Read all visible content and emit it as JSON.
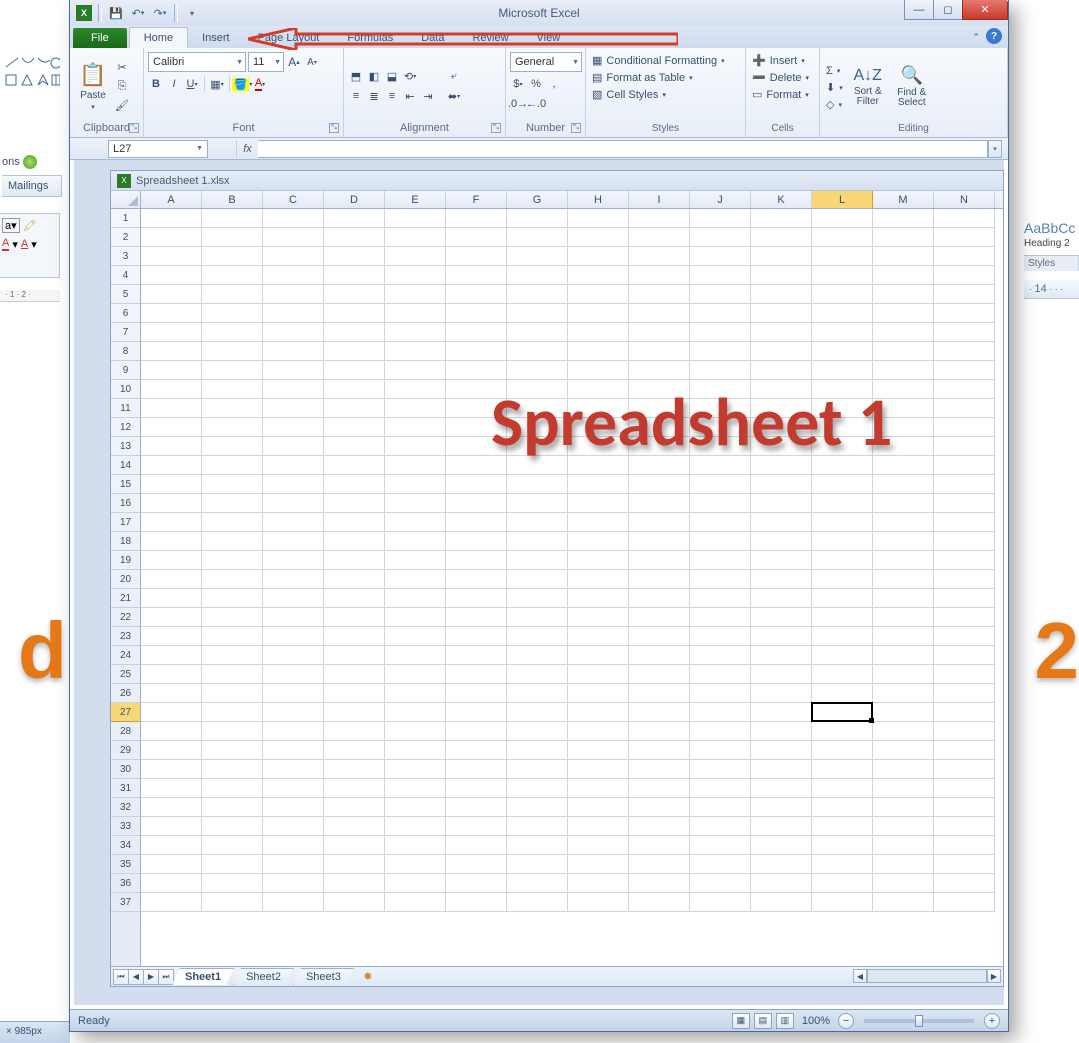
{
  "background_app": {
    "partial_tab": "Mailings",
    "partial_ons": "ons",
    "style_sample": "AaBbCc",
    "style_name": "Heading 2",
    "style_group": "Styles",
    "ruler_label": "14",
    "status_dims": "× 985px",
    "big_d": "d",
    "big_2": "2"
  },
  "excel": {
    "title": "Microsoft Excel",
    "qat_tooltip": {
      "save": "Save",
      "undo": "Undo",
      "redo": "Redo"
    },
    "tabs": [
      "File",
      "Home",
      "Insert",
      "Page Layout",
      "Formulas",
      "Data",
      "Review",
      "View"
    ],
    "active_tab": "Home",
    "ribbon": {
      "clipboard": {
        "label": "Clipboard",
        "paste": "Paste"
      },
      "font": {
        "label": "Font",
        "name": "Calibri",
        "size": "11"
      },
      "alignment": {
        "label": "Alignment"
      },
      "number": {
        "label": "Number",
        "format": "General"
      },
      "styles": {
        "label": "Styles",
        "cond": "Conditional Formatting",
        "table": "Format as Table",
        "cell": "Cell Styles"
      },
      "cells": {
        "label": "Cells",
        "insert": "Insert",
        "delete": "Delete",
        "format": "Format"
      },
      "editing": {
        "label": "Editing",
        "sort": "Sort & Filter",
        "find": "Find & Select"
      }
    },
    "namebox": "L27",
    "document_title": "Spreadsheet 1.xlsx",
    "columns": [
      "A",
      "B",
      "C",
      "D",
      "E",
      "F",
      "G",
      "H",
      "I",
      "J",
      "K",
      "L",
      "M",
      "N"
    ],
    "rows": [
      1,
      2,
      3,
      4,
      5,
      6,
      7,
      8,
      9,
      10,
      11,
      12,
      13,
      14,
      15,
      16,
      17,
      18,
      19,
      20,
      21,
      22,
      23,
      24,
      25,
      26,
      27,
      28,
      29,
      30,
      31,
      32,
      33,
      34,
      35,
      36,
      37
    ],
    "selected_col": "L",
    "selected_row": 27,
    "overlay_text": "Spreadsheet 1",
    "sheet_tabs": [
      "Sheet1",
      "Sheet2",
      "Sheet3"
    ],
    "active_sheet": "Sheet1",
    "status": "Ready",
    "zoom": "100%"
  }
}
